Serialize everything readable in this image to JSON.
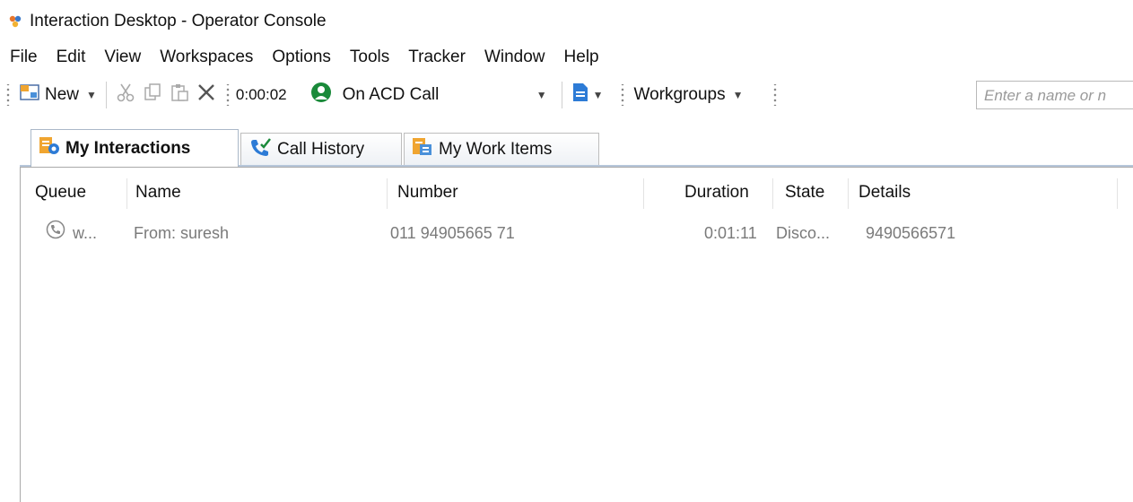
{
  "window": {
    "title": "Interaction Desktop - Operator Console"
  },
  "menu": [
    "File",
    "Edit",
    "View",
    "Workspaces",
    "Options",
    "Tools",
    "Tracker",
    "Window",
    "Help"
  ],
  "toolbar": {
    "new_label": "New",
    "timer": "0:00:02",
    "status_label": "On ACD Call",
    "workgroups_label": "Workgroups",
    "search_placeholder": "Enter a name or n"
  },
  "tabs": [
    {
      "label": "My Interactions",
      "active": true
    },
    {
      "label": "Call History",
      "active": false
    },
    {
      "label": "My Work Items",
      "active": false
    }
  ],
  "table": {
    "columns": [
      "Queue",
      "Name",
      "Number",
      "Duration",
      "State",
      "Details"
    ],
    "rows": [
      {
        "queue": "w...",
        "name": "From: suresh",
        "number": "011 94905665 71",
        "duration": "0:01:11",
        "state": "Disco...",
        "details": "9490566571"
      }
    ]
  },
  "colors": {
    "status_green": "#1a8a3a",
    "accent_blue": "#2d7bd6",
    "tab_orange": "#f0a530"
  }
}
